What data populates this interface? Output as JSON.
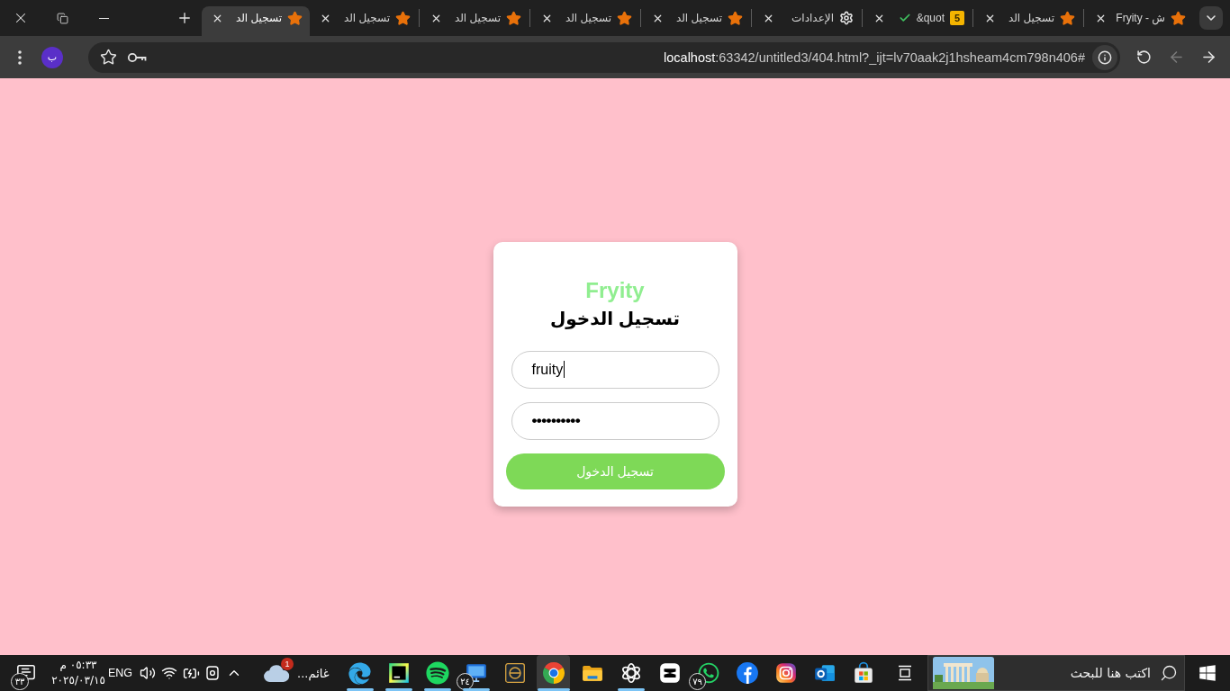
{
  "tabs": [
    {
      "title": "ش - Fryity",
      "kind": "star",
      "check": false,
      "selected": false
    },
    {
      "title": "تسجيل الد",
      "kind": "star",
      "check": false,
      "selected": false
    },
    {
      "title": "&quot",
      "kind": "badge",
      "badge": "5",
      "check": true,
      "selected": false
    },
    {
      "title": "الإعدادات",
      "kind": "gear",
      "check": false,
      "selected": false
    },
    {
      "title": "تسجيل الد",
      "kind": "star",
      "check": false,
      "selected": false
    },
    {
      "title": "تسجيل الد",
      "kind": "star",
      "check": false,
      "selected": false
    },
    {
      "title": "تسجيل الد",
      "kind": "star",
      "check": false,
      "selected": false
    },
    {
      "title": "تسجيل الد",
      "kind": "star",
      "check": false,
      "selected": false
    },
    {
      "title": "تسجيل الد",
      "kind": "star",
      "check": false,
      "selected": true
    }
  ],
  "toolbar": {
    "back_disabled": false,
    "forward_disabled": true,
    "url_host": "localhost",
    "url_rest": ":63342/untitled3/404.html?_ijt=lv70aak2j1hsheam4cm798n406#",
    "bookmarked": false,
    "profile_initial": "ب"
  },
  "login": {
    "brand": "Fryity",
    "title": "تسجيل الدخول",
    "fields": [
      {
        "kind": "text",
        "value": "fruity",
        "focused": true
      },
      {
        "kind": "password",
        "value": "••••••••••",
        "focused": false
      }
    ],
    "submit": "تسجيل الدخول"
  },
  "taskbar": {
    "search_placeholder": "اكتب هنا للبحث",
    "apps": [
      {
        "kind": "store",
        "running": false,
        "active": false
      },
      {
        "kind": "outlook",
        "running": false,
        "active": false
      },
      {
        "kind": "instagram",
        "running": false,
        "active": false
      },
      {
        "kind": "facebook",
        "running": false,
        "active": false
      },
      {
        "kind": "whatsapp",
        "badge": "٧٩",
        "running": false,
        "active": false
      },
      {
        "kind": "capcut",
        "running": false,
        "active": false
      },
      {
        "kind": "chatgpt",
        "running": true,
        "active": false
      },
      {
        "kind": "folder",
        "running": false,
        "active": false
      },
      {
        "kind": "chrome",
        "running": true,
        "active": true
      },
      {
        "kind": "e-logo",
        "running": false,
        "active": false
      },
      {
        "kind": "monitor",
        "badge": "٢٤",
        "running": true,
        "active": false
      },
      {
        "kind": "spotify",
        "running": true,
        "active": false
      },
      {
        "kind": "pycharm",
        "running": true,
        "active": false
      },
      {
        "kind": "edge",
        "running": true,
        "active": false
      }
    ],
    "weather": {
      "text": "غائم...",
      "badge": "1"
    },
    "language": "ENG",
    "time": "٠٥:٣٣ م",
    "date": "٢٠٢٥/٠٣/١٥",
    "notification_badge": "٣٣"
  }
}
